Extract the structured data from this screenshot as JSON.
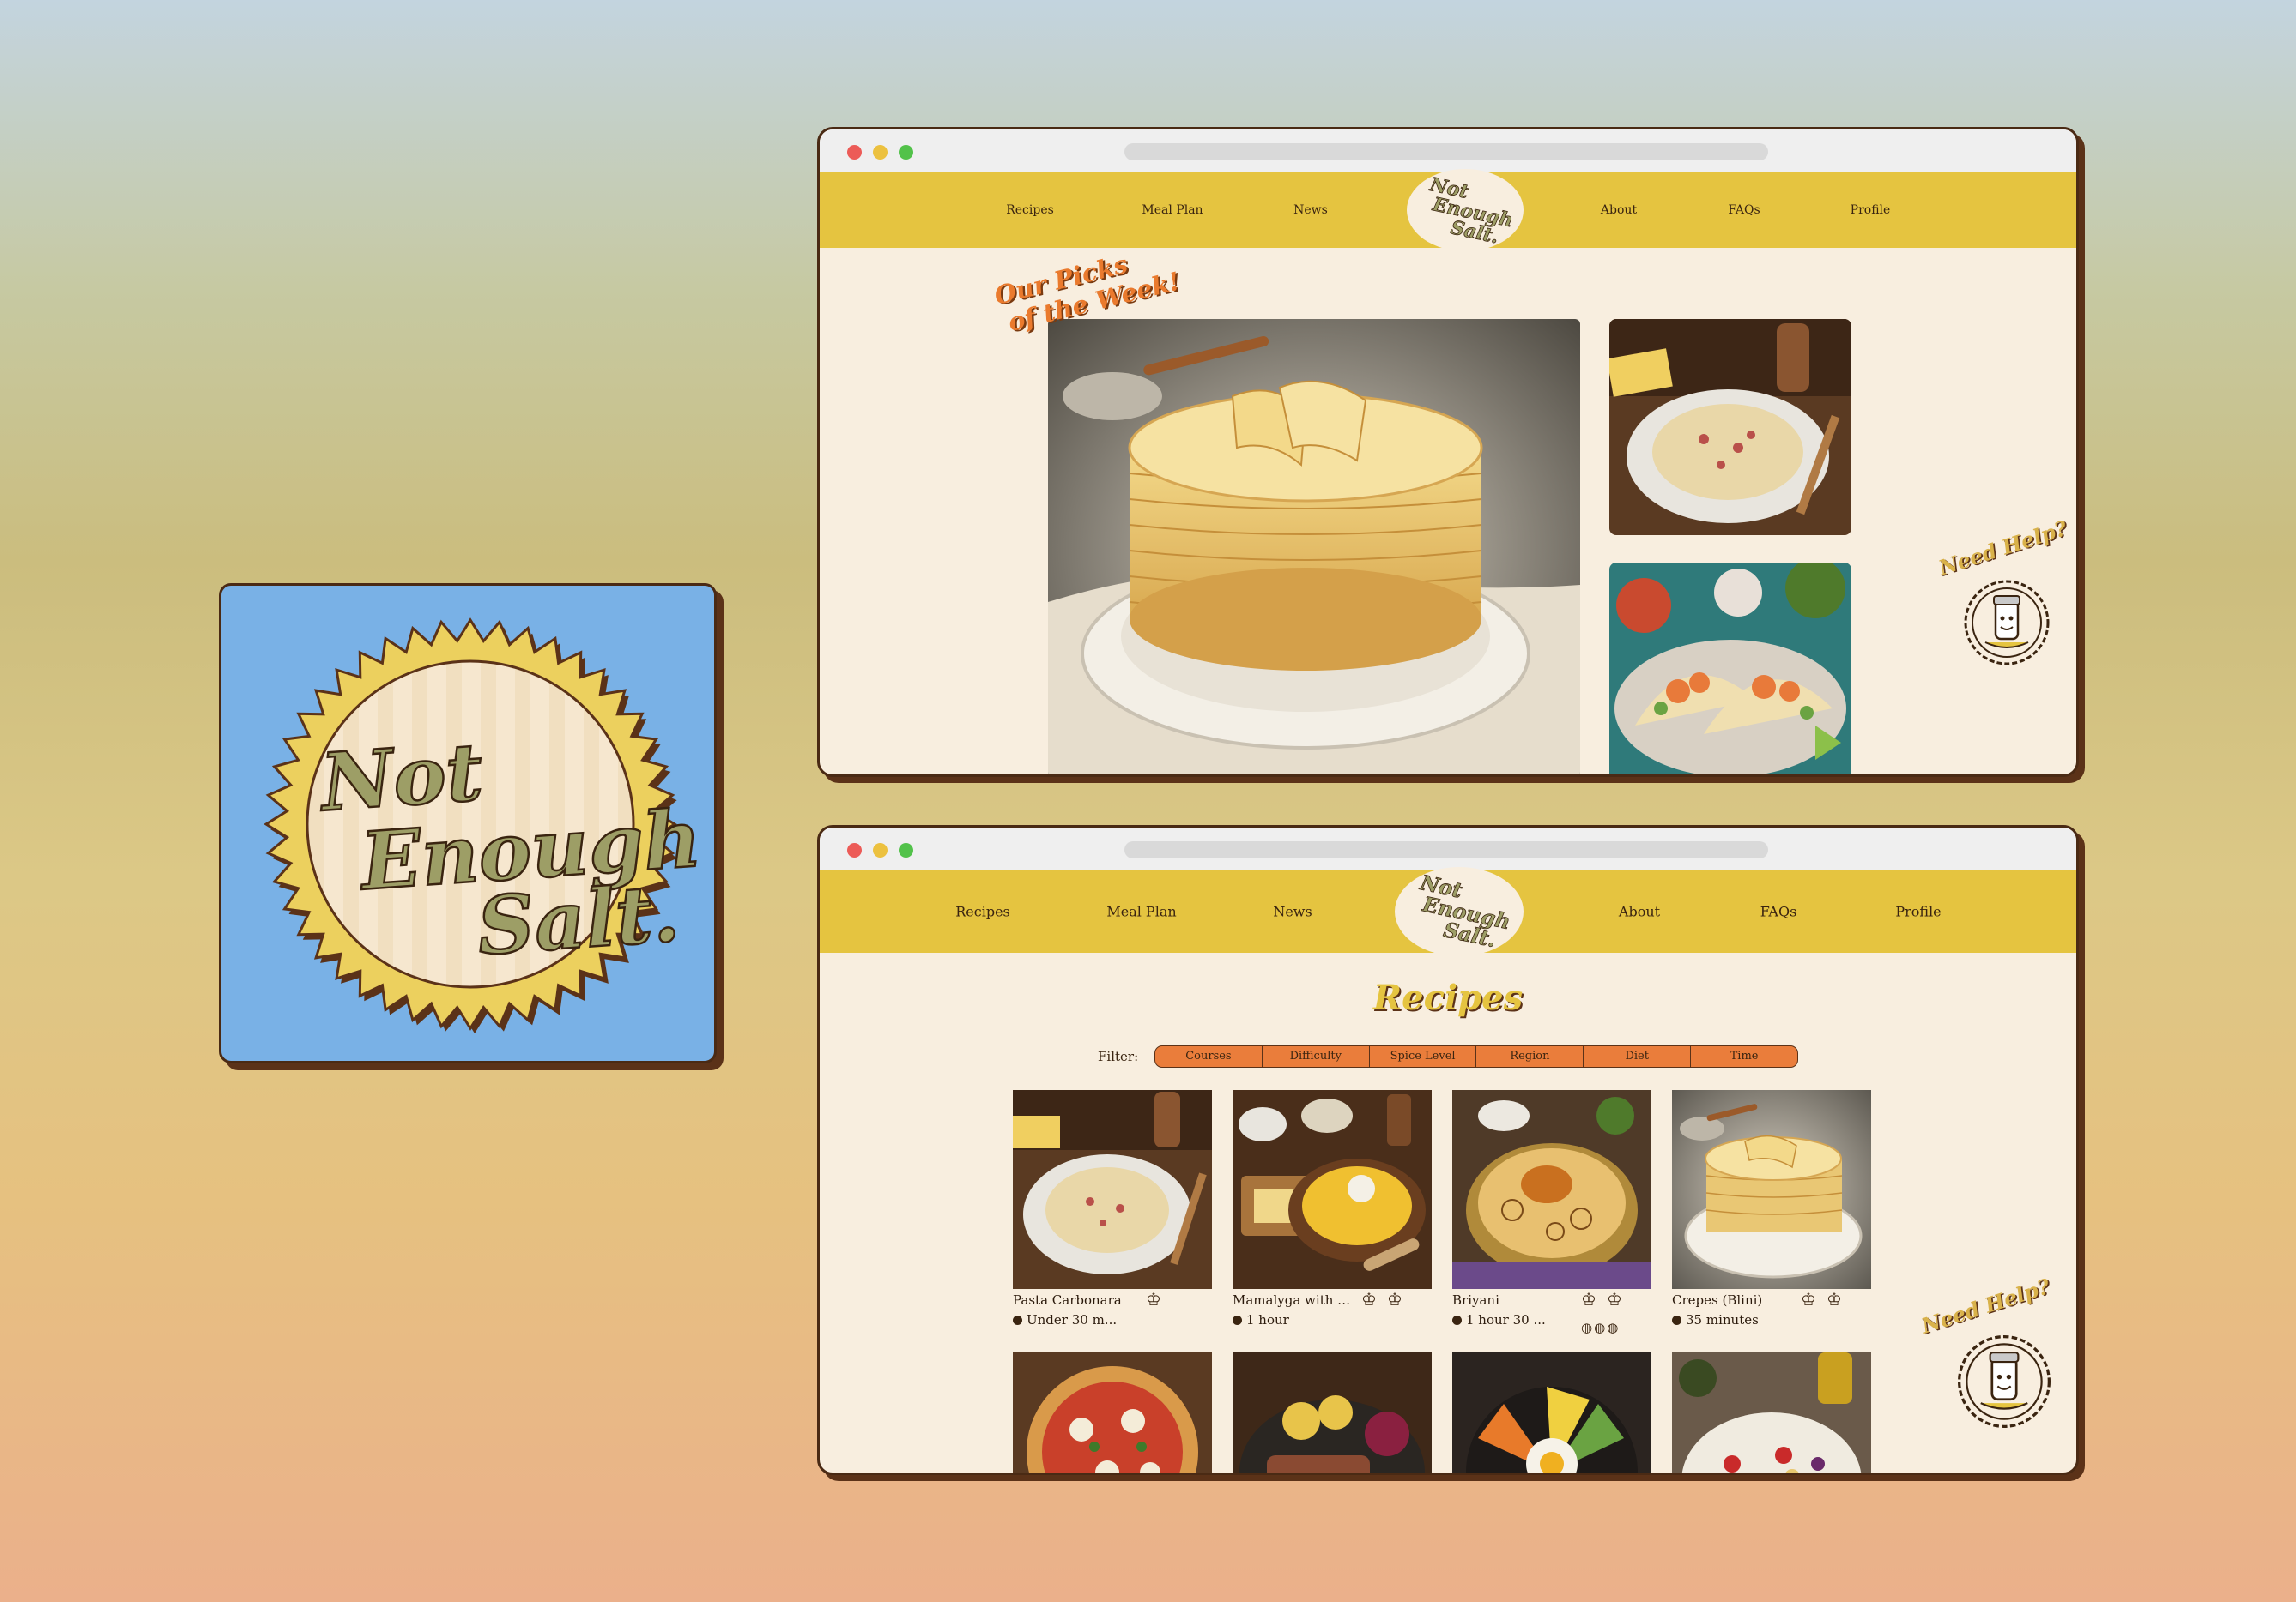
{
  "brand": {
    "logo_lines": [
      "Not",
      "Enough",
      "Salt."
    ],
    "colors": {
      "yellow": "#e5c440",
      "cream": "#f8eedf",
      "orange": "#ea7d3b",
      "brown": "#5b3218",
      "logo_green": "#9d9e66",
      "tile_blue": "#79b1e6"
    }
  },
  "nav": {
    "items": [
      "Recipes",
      "Meal Plan",
      "News",
      "About",
      "FAQs",
      "Profile"
    ]
  },
  "home": {
    "picks_line1": "Our Picks",
    "picks_line2": "of the Week!",
    "hero_image": "crepes-stack",
    "side_images": [
      "pasta-carbonara",
      "shrimp-tacos"
    ],
    "help_label": "Need Help?"
  },
  "recipes_page": {
    "title": "Recipes",
    "filter_label": "Filter:",
    "filters": [
      "Courses",
      "Difficulty",
      "Spice Level",
      "Region",
      "Diet",
      "Time"
    ],
    "cards": [
      {
        "name": "Pasta Carbonara",
        "time": "Under 30 m...",
        "difficulty_icons": 1,
        "spice_icons": 0,
        "image": "pasta"
      },
      {
        "name": "Mamalyga with M...",
        "time": "1 hour",
        "difficulty_icons": 2,
        "spice_icons": 0,
        "image": "mamalyga"
      },
      {
        "name": "Briyani",
        "time": "1 hour 30 ...",
        "difficulty_icons": 2,
        "spice_icons": 3,
        "image": "briyani"
      },
      {
        "name": "Crepes (Blini)",
        "time": "35 minutes",
        "difficulty_icons": 2,
        "spice_icons": 0,
        "image": "crepes"
      }
    ],
    "more_card_images": [
      "pizza",
      "steak-potatoes",
      "bibimbap",
      "bean-salad"
    ],
    "help_label": "Need Help?"
  }
}
